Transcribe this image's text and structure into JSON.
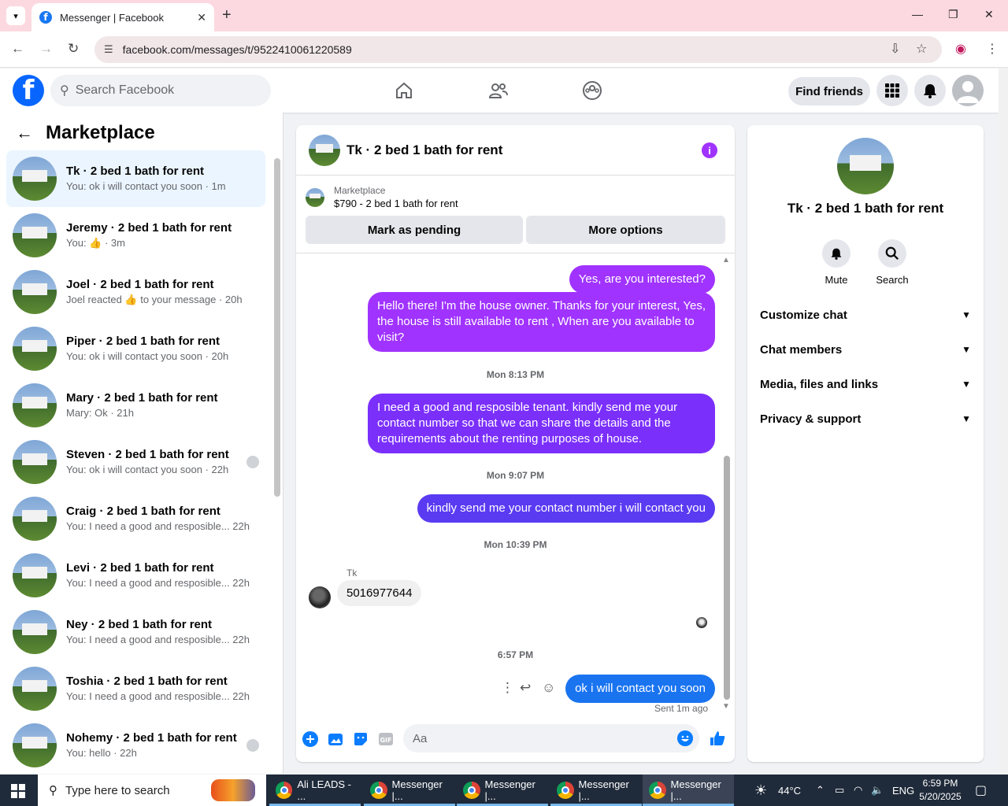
{
  "browser": {
    "tab_title": "Messenger | Facebook",
    "url": "facebook.com/messages/t/9522410061220589"
  },
  "fb": {
    "search_placeholder": "Search Facebook",
    "find_friends": "Find friends"
  },
  "sidebar": {
    "title": "Marketplace",
    "conversations": [
      {
        "name": "Tk · 2 bed 1 bath for rent",
        "preview": "You: ok i will contact you soon · 1m",
        "active": true
      },
      {
        "name": "Jeremy · 2 bed 1 bath for rent",
        "preview": "You: 👍 · 3m"
      },
      {
        "name": "Joel · 2 bed 1 bath for rent",
        "preview": "Joel reacted 👍 to your message · 20h"
      },
      {
        "name": "Piper · 2 bed 1 bath for rent",
        "preview": "You: ok i will contact you soon · 20h"
      },
      {
        "name": "Mary · 2 bed 1 bath for rent",
        "preview": "Mary: Ok · 21h"
      },
      {
        "name": "Steven · 2 bed 1 bath for rent",
        "preview": "You: ok i will contact you soon · 22h"
      },
      {
        "name": "Craig · 2 bed 1 bath for rent",
        "preview": "You: I need a good and resposible...  22h"
      },
      {
        "name": "Levi · 2 bed 1 bath for rent",
        "preview": "You: I need a good and resposible...  22h"
      },
      {
        "name": "Ney · 2 bed 1 bath for rent",
        "preview": "You: I need a good and resposible...  22h"
      },
      {
        "name": "Toshia · 2 bed 1 bath for rent",
        "preview": "You: I need a good and resposible...  22h"
      },
      {
        "name": "Nohemy · 2 bed 1 bath for rent",
        "preview": "You: hello · 22h"
      }
    ]
  },
  "chat": {
    "title": "Tk · 2 bed 1 bath for rent",
    "marketplace_label": "Marketplace",
    "listing": "$790 - 2 bed 1 bath for rent",
    "mark_pending": "Mark as pending",
    "more_options": "More options",
    "messages": {
      "m1": "Yes, are you interested?",
      "m2": "Hello there! I'm the house owner. Thanks for your interest, Yes, the house is still available to rent , When are you available to visit?",
      "t1": "Mon 8:13 PM",
      "m3": "I need a good and resposible tenant.  kindly send me your contact number so that we can share the details and the requirements about the renting purposes of house.",
      "t2": "Mon 9:07 PM",
      "m4": "kindly  send me your  contact  number i will  contact  you",
      "t3": "Mon 10:39 PM",
      "sender": "Tk",
      "m5": "5016977644",
      "t4": "6:57 PM",
      "m6": "ok i will contact you soon",
      "sent": "Sent 1m ago"
    },
    "composer_placeholder": "Aa"
  },
  "details": {
    "name": "Tk · 2 bed 1 bath for rent",
    "mute": "Mute",
    "search": "Search",
    "sections": [
      "Customize chat",
      "Chat members",
      "Media, files and links",
      "Privacy & support"
    ]
  },
  "taskbar": {
    "search": "Type here to search",
    "apps": [
      "Ali LEADS - ...",
      "Messenger |...",
      "Messenger |...",
      "Messenger |...",
      "Messenger |..."
    ],
    "temp": "44°C",
    "lang": "ENG",
    "time": "6:59 PM",
    "date": "5/20/2025"
  }
}
